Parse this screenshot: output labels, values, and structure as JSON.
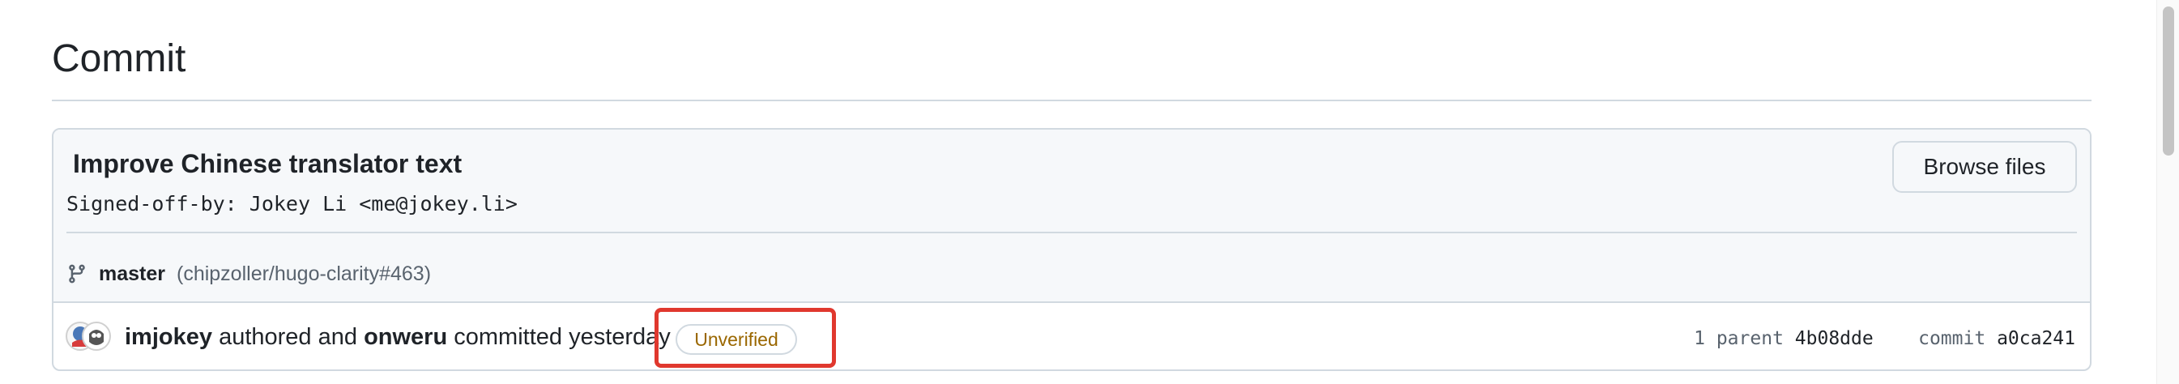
{
  "page": {
    "title": "Commit"
  },
  "commit": {
    "title": "Improve Chinese translator text",
    "description": "Signed-off-by: Jokey Li <me@jokey.li>",
    "browse_files_label": "Browse files",
    "branch": "master",
    "branch_ref": "(chipzoller/hugo-clarity#463)",
    "author": "imjokey",
    "authored_text": "authored and",
    "committer": "onweru",
    "committed_text": "committed yesterday",
    "verification_badge": "Unverified",
    "parent_count_label": "1 parent",
    "parent_sha": "4b08dde",
    "commit_label": "commit",
    "commit_sha": "a0ca241"
  },
  "icons": {
    "branch": "git-branch-icon",
    "avatar": "user-avatar"
  },
  "colors": {
    "highlight": "#e0382e",
    "unverified": "#9a6700"
  }
}
